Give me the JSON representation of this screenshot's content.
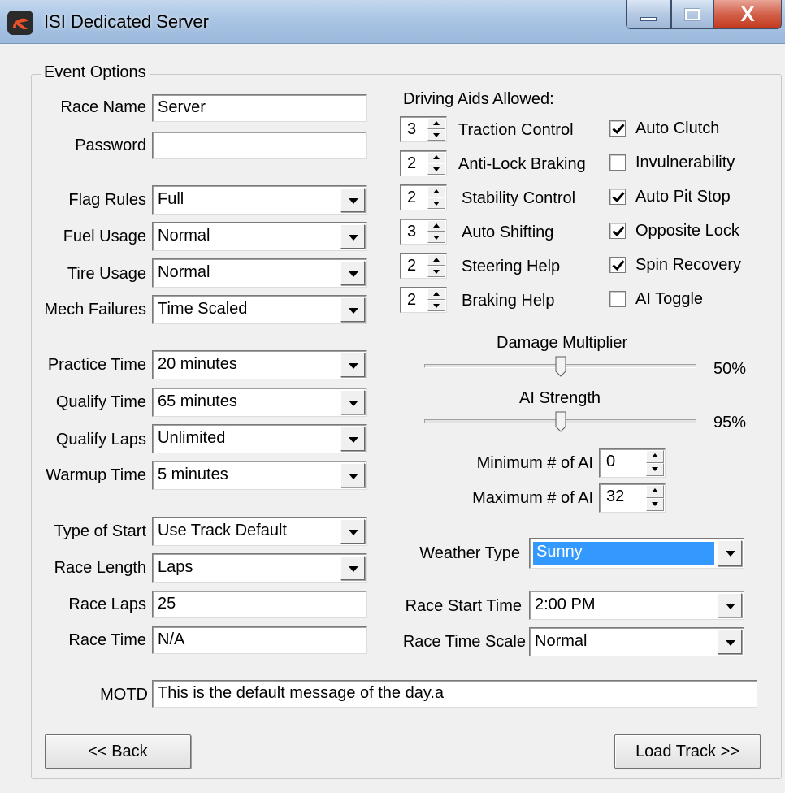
{
  "window": {
    "title": "ISI Dedicated Server",
    "icon": "isi-logo-icon",
    "close_glyph": "X"
  },
  "event_options": {
    "group_title": "Event Options",
    "race_name": {
      "label": "Race Name",
      "value": "Server"
    },
    "password": {
      "label": "Password",
      "value": ""
    },
    "flag_rules": {
      "label": "Flag Rules",
      "value": "Full"
    },
    "fuel_usage": {
      "label": "Fuel Usage",
      "value": "Normal"
    },
    "tire_usage": {
      "label": "Tire Usage",
      "value": "Normal"
    },
    "mech_failures": {
      "label": "Mech Failures",
      "value": "Time Scaled"
    },
    "practice_time": {
      "label": "Practice Time",
      "value": "20 minutes"
    },
    "qualify_time": {
      "label": "Qualify Time",
      "value": "65 minutes"
    },
    "qualify_laps": {
      "label": "Qualify Laps",
      "value": "Unlimited"
    },
    "warmup_time": {
      "label": "Warmup Time",
      "value": "5 minutes"
    },
    "type_of_start": {
      "label": "Type of Start",
      "value": "Use Track Default"
    },
    "race_length": {
      "label": "Race Length",
      "value": "Laps"
    },
    "race_laps": {
      "label": "Race Laps",
      "value": "25"
    },
    "race_time": {
      "label": "Race Time",
      "value": "N/A"
    },
    "motd": {
      "label": "MOTD",
      "value": "This is the default message of the day.a"
    }
  },
  "driving_aids": {
    "heading": "Driving Aids Allowed:",
    "spinners": [
      {
        "label": "Traction Control",
        "value": "3"
      },
      {
        "label": "Anti-Lock Braking",
        "value": "2"
      },
      {
        "label": "Stability Control",
        "value": "2"
      },
      {
        "label": "Auto Shifting",
        "value": "3"
      },
      {
        "label": "Steering Help",
        "value": "2"
      },
      {
        "label": "Braking Help",
        "value": "2"
      }
    ],
    "checkboxes": [
      {
        "label": "Auto Clutch",
        "checked": true
      },
      {
        "label": "Invulnerability",
        "checked": false
      },
      {
        "label": "Auto Pit Stop",
        "checked": true
      },
      {
        "label": "Opposite Lock",
        "checked": true
      },
      {
        "label": "Spin Recovery",
        "checked": true
      },
      {
        "label": "AI Toggle",
        "checked": false
      }
    ]
  },
  "damage_multiplier": {
    "label": "Damage Multiplier",
    "value_text": "50%",
    "level": 0.5
  },
  "ai_strength": {
    "label": "AI Strength",
    "value_text": "95%",
    "level": 0.5
  },
  "min_ai": {
    "label": "Minimum # of AI",
    "value": "0"
  },
  "max_ai": {
    "label": "Maximum # of AI",
    "value": "32"
  },
  "weather_type": {
    "label": "Weather Type",
    "value": "Sunny"
  },
  "race_start_time": {
    "label": "Race Start Time",
    "value": "2:00 PM"
  },
  "race_time_scale": {
    "label": "Race Time Scale",
    "value": "Normal"
  },
  "buttons": {
    "back": "<< Back",
    "load_track": "Load Track >>"
  }
}
